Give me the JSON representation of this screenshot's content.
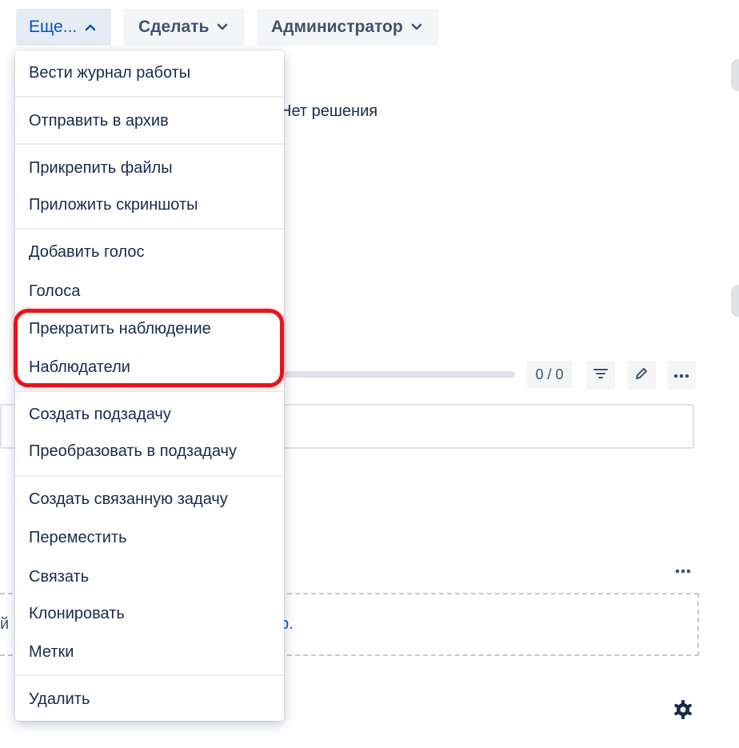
{
  "toolbar": {
    "more_label": "Еще...",
    "do_label": "Сделать",
    "admin_label": "Администратор"
  },
  "background": {
    "resolution_text": "Нет решения",
    "counter_text": "0 / 0",
    "dropzone_left_text": "й",
    "dropzone_link_text": "р."
  },
  "menu": {
    "groups": [
      {
        "items": [
          "Вести журнал работы"
        ]
      },
      {
        "items": [
          "Отправить в архив"
        ]
      },
      {
        "items": [
          "Прикрепить файлы",
          "Приложить скриншоты"
        ]
      },
      {
        "items": [
          "Добавить голос",
          "Голоса",
          "Прекратить наблюдение",
          "Наблюдатели"
        ]
      },
      {
        "items": [
          "Создать подзадачу",
          "Преобразовать в подзадачу"
        ]
      },
      {
        "items": [
          "Создать связанную задачу",
          "Переместить",
          "Связать",
          "Клонировать",
          "Метки"
        ]
      },
      {
        "items": [
          "Удалить"
        ]
      }
    ]
  },
  "colors": {
    "accent": "#0052cc",
    "highlight": "#e8141c",
    "text": "#172b4d"
  }
}
